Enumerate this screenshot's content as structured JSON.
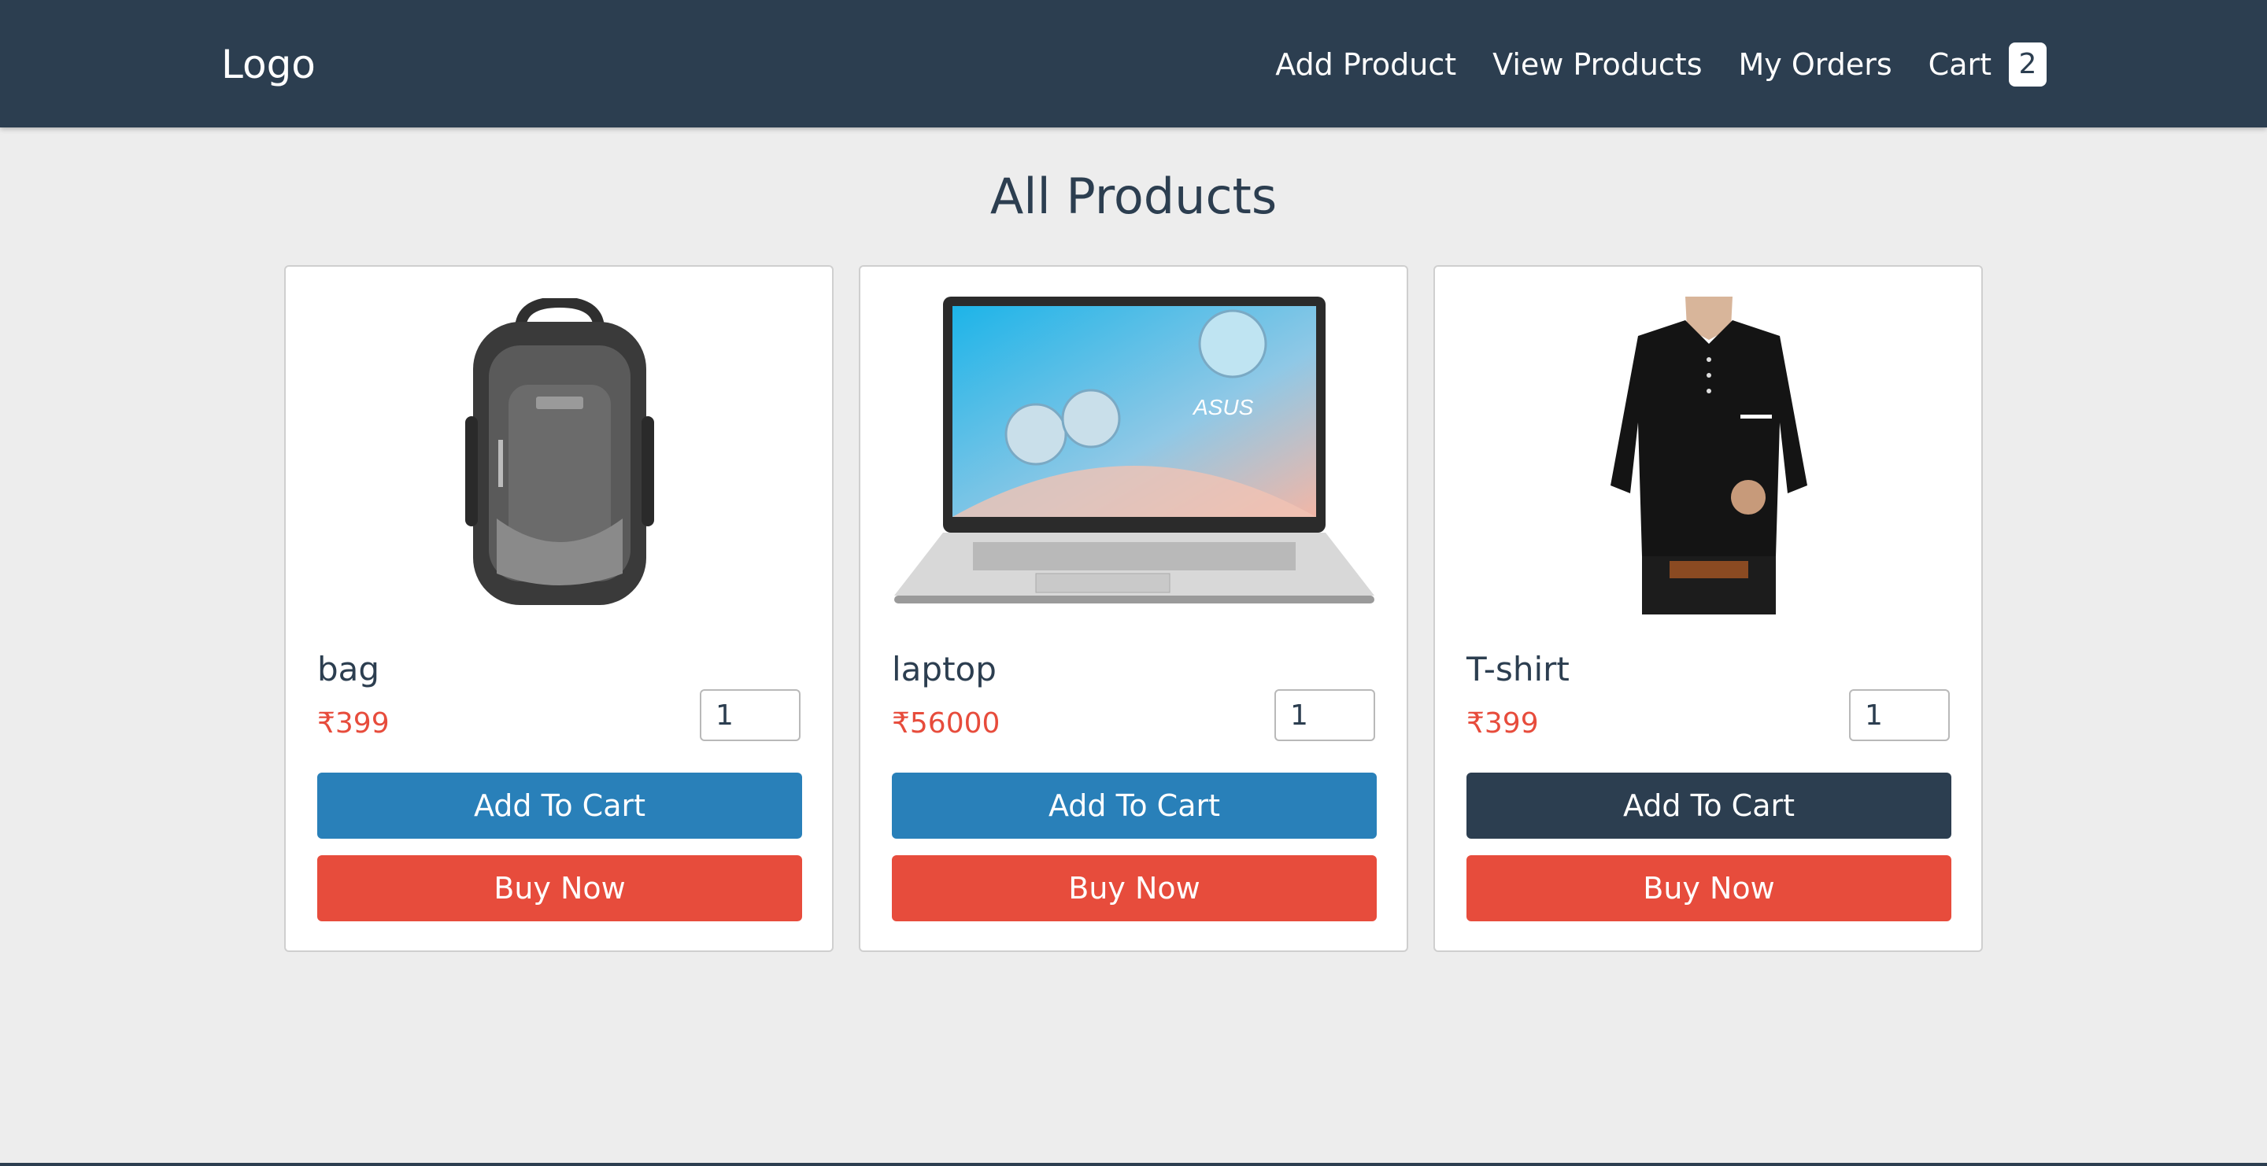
{
  "navbar": {
    "logo": "Logo",
    "links": [
      "Add Product",
      "View Products",
      "My Orders"
    ],
    "cart_label": "Cart",
    "cart_count": "2"
  },
  "page": {
    "title": "All Products"
  },
  "products": [
    {
      "name": "bag",
      "price": "₹399",
      "quantity": "1",
      "add_to_cart_label": "Add To Cart",
      "buy_now_label": "Buy Now",
      "image_icon": "backpack-image"
    },
    {
      "name": "laptop",
      "price": "₹56000",
      "quantity": "1",
      "add_to_cart_label": "Add To Cart",
      "buy_now_label": "Buy Now",
      "image_icon": "laptop-image",
      "brand_on_image": "ASUS"
    },
    {
      "name": "T-shirt",
      "price": "₹399",
      "quantity": "1",
      "add_to_cart_label": "Add To Cart",
      "buy_now_label": "Buy Now",
      "image_icon": "tshirt-image"
    }
  ],
  "colors": {
    "navbar": "#2c3e50",
    "accent_blue": "#2980b9",
    "accent_red": "#e74c3c",
    "page_bg": "#ededed"
  }
}
